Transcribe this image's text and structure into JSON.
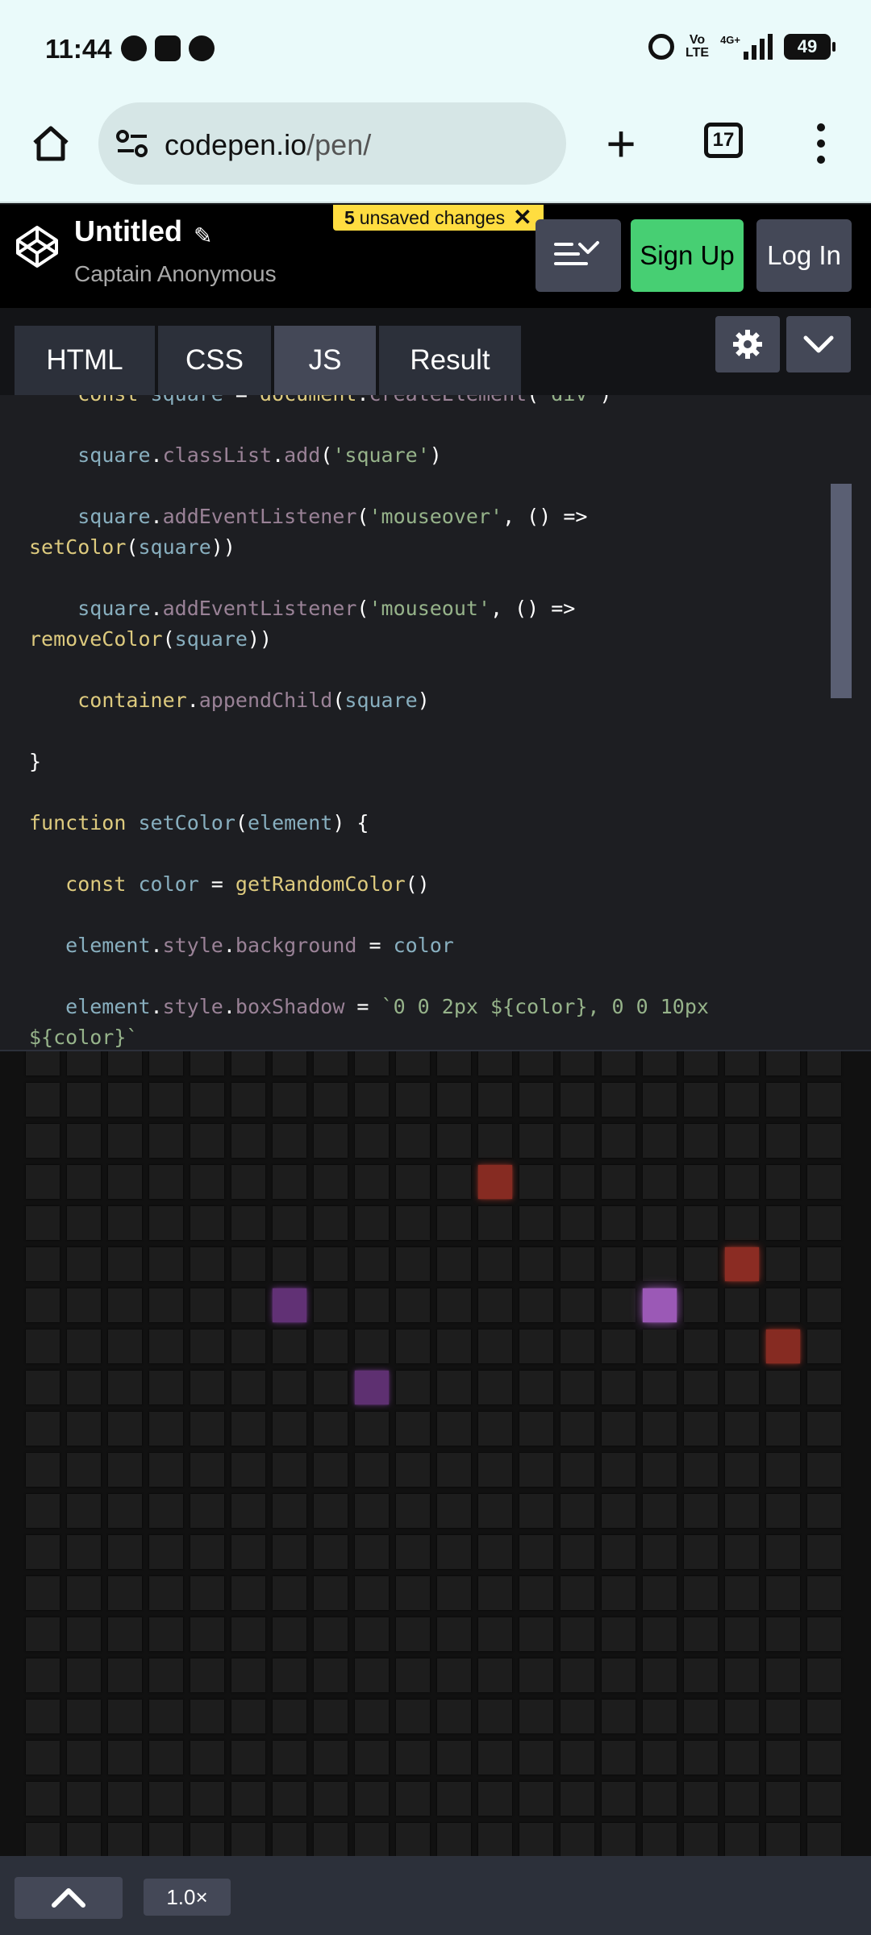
{
  "status_bar": {
    "time": "11:44",
    "volte_top": "Vo",
    "volte_bottom": "LTE",
    "network": "4G+",
    "battery": "49"
  },
  "browser": {
    "url_domain": "codepen.io",
    "url_path": "/pen/",
    "tab_count": "17"
  },
  "codepen": {
    "title": "Untitled",
    "author": "Captain Anonymous",
    "unsaved_count": "5",
    "unsaved_text": "unsaved changes",
    "signup_label": "Sign Up",
    "login_label": "Log In",
    "accent": "#47cf73",
    "badge_color": "#ffdd40"
  },
  "editor": {
    "tabs": [
      "HTML",
      "CSS",
      "JS",
      "Result"
    ],
    "active_tab": "JS"
  },
  "code_lines": [
    "    const square = document.createElement('div')",
    "    square.classList.add('square')",
    "    square.addEventListener('mouseover', () =>",
    "setColor(square))",
    "    square.addEventListener('mouseout', () =>",
    "removeColor(square))",
    "    container.appendChild(square)",
    "}",
    "function setColor(element) {",
    "   const color = getRandomColor()",
    "   element.style.background = color",
    "   element.style.boxShadow = `0 0 2px ${color}, 0 0 10px",
    "${color}`"
  ],
  "result": {
    "lit_squares": [
      {
        "row": 3,
        "col": 11,
        "color": "#c0392b",
        "glow": 0.4
      },
      {
        "row": 5,
        "col": 17,
        "color": "#c0392b",
        "glow": 0.45
      },
      {
        "row": 6,
        "col": 6,
        "color": "#8e44ad",
        "glow": 0.35
      },
      {
        "row": 6,
        "col": 15,
        "color": "#9b59b6",
        "glow": 1
      },
      {
        "row": 7,
        "col": 18,
        "color": "#c0392b",
        "glow": 0.4
      },
      {
        "row": 8,
        "col": 8,
        "color": "#8e44ad",
        "glow": 0.3
      }
    ]
  },
  "bottom": {
    "zoom": "1.0×"
  }
}
